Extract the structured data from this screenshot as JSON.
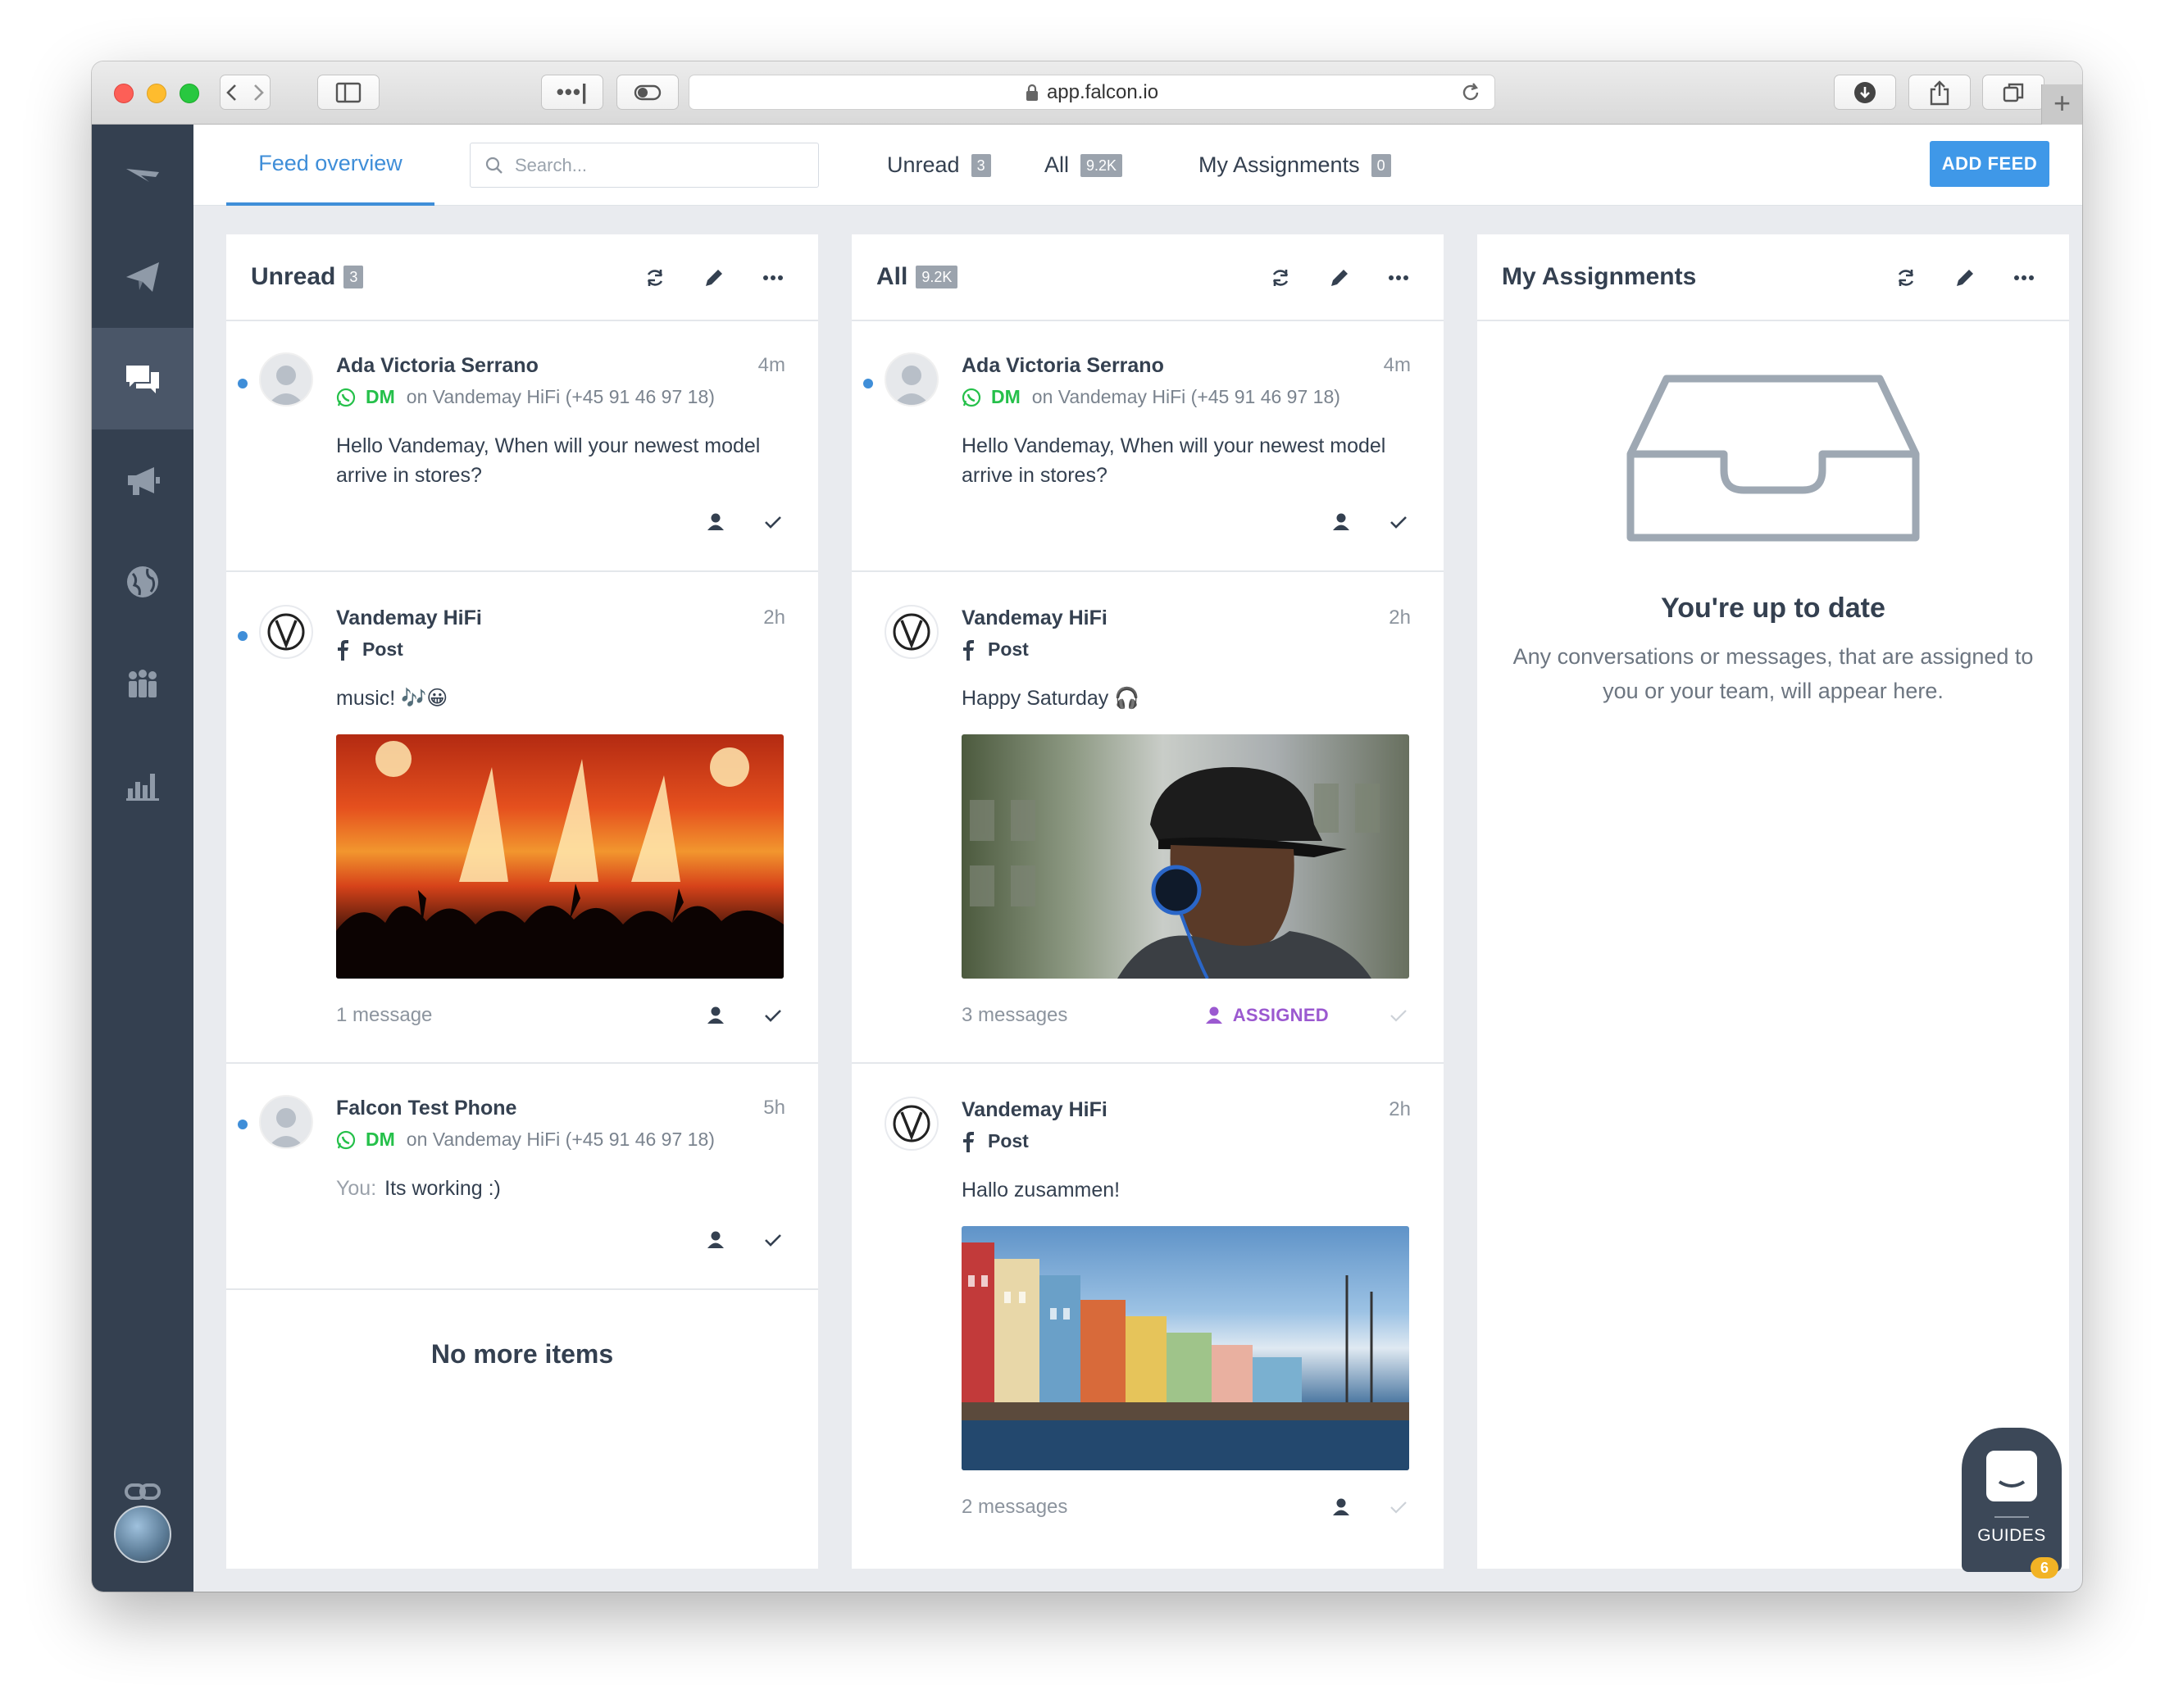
{
  "browser": {
    "url": "app.falcon.io"
  },
  "topbar": {
    "tab_feed_overview": "Feed overview",
    "search_placeholder": "Search...",
    "counters": [
      {
        "label": "Unread",
        "count": "3"
      },
      {
        "label": "All",
        "count": "9.2K"
      },
      {
        "label": "My Assignments",
        "count": "0"
      }
    ],
    "add_feed": "ADD FEED"
  },
  "sidebar": {
    "icons": [
      "falcon-logo-icon",
      "publish-icon",
      "engage-chat-icon",
      "advertise-megaphone-icon",
      "listen-globe-icon",
      "audience-people-icon",
      "measure-chart-icon",
      "link-icon",
      "user-avatar"
    ]
  },
  "columns": [
    {
      "title": "Unread",
      "badge": "3",
      "cards": [
        {
          "author": "Ada Victoria Serrano",
          "time": "4m",
          "channel": "DM",
          "channel_icon": "whatsapp-icon",
          "source": "on Vandemay HiFi (+45 91 46 97 18)",
          "message": "Hello Vandemay, When will your newest model arrive in stores?"
        },
        {
          "author": "Vandemay HiFi",
          "time": "2h",
          "channel": "Post",
          "channel_icon": "facebook-icon",
          "message": "music! 🎶😀",
          "image": "concert-photo",
          "footer": "1 message"
        },
        {
          "author": "Falcon Test Phone",
          "time": "5h",
          "channel": "DM",
          "channel_icon": "whatsapp-icon",
          "source": "on Vandemay HiFi (+45 91 46 97 18)",
          "you_prefix": "You:",
          "message": "Its working :)"
        }
      ],
      "no_more": "No more items"
    },
    {
      "title": "All",
      "badge": "9.2K",
      "cards": [
        {
          "author": "Ada Victoria Serrano",
          "time": "4m",
          "channel": "DM",
          "channel_icon": "whatsapp-icon",
          "source": "on Vandemay HiFi (+45 91 46 97 18)",
          "message": "Hello Vandemay, When will your newest model arrive in stores?"
        },
        {
          "author": "Vandemay HiFi",
          "time": "2h",
          "channel": "Post",
          "channel_icon": "facebook-icon",
          "message": "Happy Saturday 🎧",
          "image": "headphones-man-photo",
          "footer": "3 messages",
          "status": "ASSIGNED"
        },
        {
          "author": "Vandemay HiFi",
          "time": "2h",
          "channel": "Post",
          "channel_icon": "facebook-icon",
          "message": "Hallo zusammen!",
          "image": "harbour-houses-photo",
          "footer": "2 messages"
        }
      ]
    },
    {
      "title": "My Assignments",
      "empty_title": "You're up to date",
      "empty_text": "Any conversations or messages, that are assigned to you or your team, will appear here."
    }
  ],
  "guides": {
    "label": "GUIDES",
    "count": "6"
  },
  "colors": {
    "accent": "#3f8ed8",
    "sidebar": "#344050",
    "whatsapp": "#25c04a",
    "assigned": "#9b59d0",
    "add_feed": "#3f98e8"
  }
}
